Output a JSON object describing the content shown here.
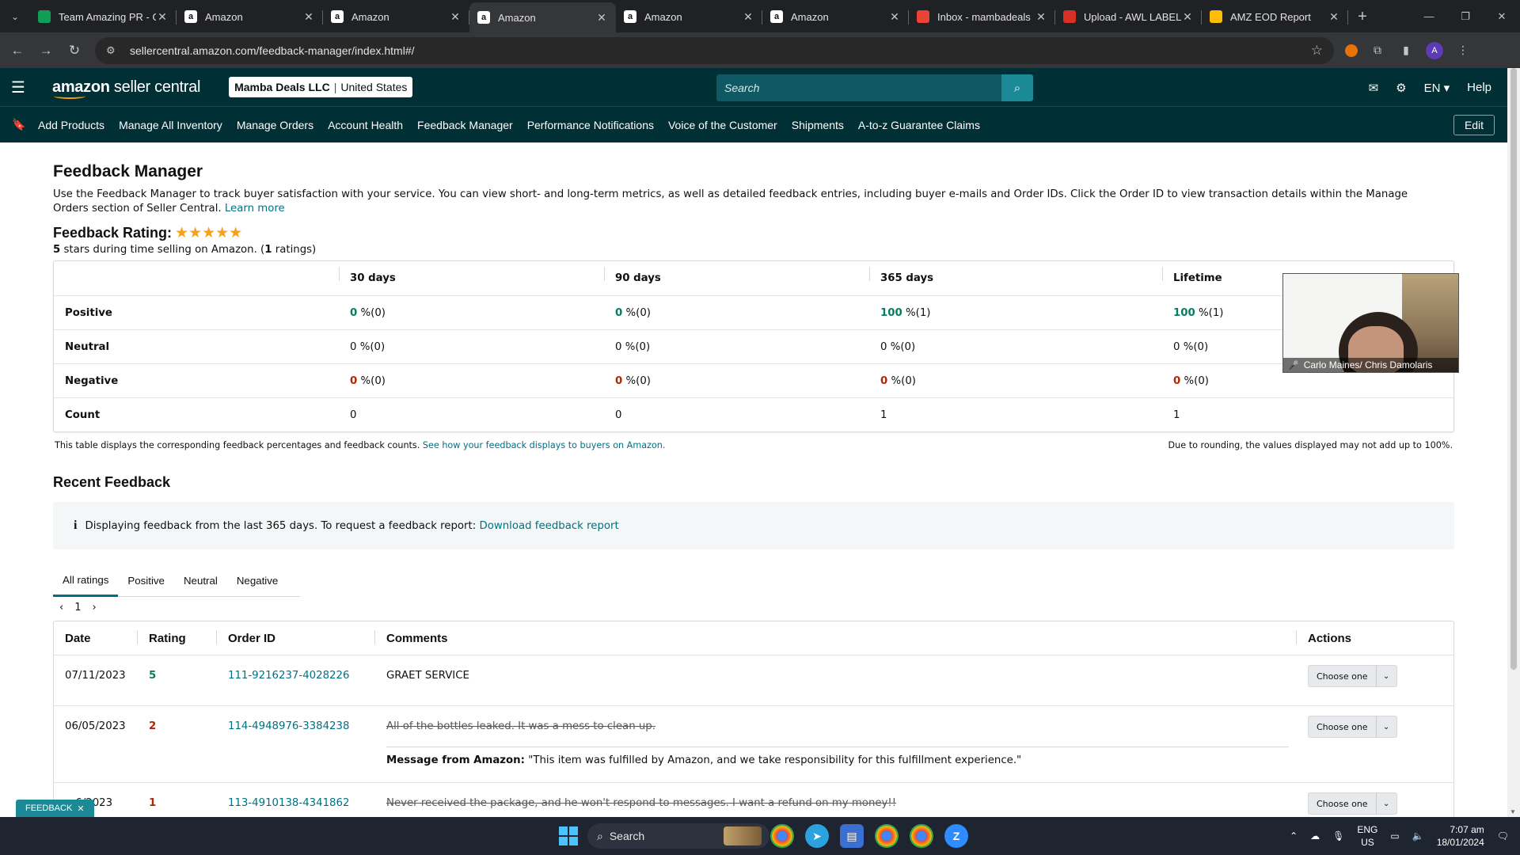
{
  "browser": {
    "tabs": [
      {
        "title": "Team Amazing PR - G",
        "icon": "sheets-icon",
        "color": "#0f9d58"
      },
      {
        "title": "Amazon",
        "icon": "amazon-icon",
        "color": "#ffffff"
      },
      {
        "title": "Amazon",
        "icon": "amazon-icon",
        "color": "#ffffff"
      },
      {
        "title": "Amazon",
        "icon": "amazon-icon",
        "color": "#ffffff",
        "active": true
      },
      {
        "title": "Amazon",
        "icon": "amazon-icon",
        "color": "#ffffff"
      },
      {
        "title": "Amazon",
        "icon": "amazon-icon",
        "color": "#ffffff"
      },
      {
        "title": "Inbox - mambadeals",
        "icon": "gmail-icon",
        "color": "#ea4335"
      },
      {
        "title": "Upload - AWL LABEL",
        "icon": "upload-icon",
        "color": "#d93025"
      },
      {
        "title": "AMZ EOD Report",
        "icon": "report-icon",
        "color": "#fbbc04"
      }
    ],
    "url": "sellercentral.amazon.com/feedback-manager/index.html#/",
    "profile_initial": "A"
  },
  "header": {
    "logo_bold": "amazon",
    "logo_rest": " seller central",
    "account_name": "Mamba Deals LLC",
    "account_region": "United States",
    "search_placeholder": "Search",
    "lang": "EN",
    "help": "Help"
  },
  "nav": {
    "items": [
      "Add Products",
      "Manage All Inventory",
      "Manage Orders",
      "Account Health",
      "Feedback Manager",
      "Performance Notifications",
      "Voice of the Customer",
      "Shipments",
      "A-to-z Guarantee Claims"
    ],
    "edit": "Edit"
  },
  "page": {
    "title": "Feedback Manager",
    "intro": "Use the Feedback Manager to track buyer satisfaction with your service. You can view short- and long-term metrics, as well as detailed feedback entries, including buyer e-mails and Order IDs. Click the Order ID to view transaction details within the Manage Orders section of Seller Central.",
    "learn_more": "Learn more",
    "rating_label": "Feedback Rating:",
    "stars": "★★★★★",
    "rating_stars_value": 5,
    "rating_sub_num": "5",
    "rating_sub_mid": " stars during time selling on Amazon. (",
    "rating_sub_count": "1",
    "rating_sub_end": " ratings)"
  },
  "summary": {
    "columns": [
      "",
      "30 days",
      "90 days",
      "365 days",
      "Lifetime"
    ],
    "rows": [
      {
        "label": "Positive",
        "cells": [
          [
            "0",
            " %(0)"
          ],
          [
            "0",
            " %(0)"
          ],
          [
            "100",
            " %(1)"
          ],
          [
            "100",
            " %(1)"
          ]
        ],
        "tone": "g"
      },
      {
        "label": "Neutral",
        "cells": [
          [
            "0",
            " %(0)"
          ],
          [
            "0",
            " %(0)"
          ],
          [
            "0",
            " %(0)"
          ],
          [
            "0",
            " %(0)"
          ]
        ],
        "tone": "n"
      },
      {
        "label": "Negative",
        "cells": [
          [
            "0",
            " %(0)"
          ],
          [
            "0",
            " %(0)"
          ],
          [
            "0",
            " %(0)"
          ],
          [
            "0",
            " %(0)"
          ]
        ],
        "tone": "r"
      },
      {
        "label": "Count",
        "cells": [
          [
            "",
            "0"
          ],
          [
            "",
            "0"
          ],
          [
            "",
            "1"
          ],
          [
            "",
            "1"
          ]
        ],
        "tone": "n"
      }
    ],
    "note_left": "This table displays the corresponding feedback percentages and feedback counts.",
    "note_link": "See how your feedback displays to buyers on Amazon.",
    "note_right": "Due to rounding, the values displayed may not add up to 100%."
  },
  "recent": {
    "title": "Recent Feedback",
    "info_text": "Displaying feedback from the last 365 days. To request a feedback report:",
    "info_link": "Download feedback report",
    "tabs": [
      "All ratings",
      "Positive",
      "Neutral",
      "Negative"
    ],
    "page": "1",
    "columns": [
      "Date",
      "Rating",
      "Order ID",
      "Comments",
      "Actions"
    ],
    "rows": [
      {
        "date": "07/11/2023",
        "rating": "5",
        "tone": "g",
        "order": "111-9216237-4028226",
        "comment": "GRAET SERVICE",
        "strike": false,
        "message": null
      },
      {
        "date": "06/05/2023",
        "rating": "2",
        "tone": "r",
        "order": "114-4948976-3384238",
        "comment": "All of the bottles leaked. It was a mess to clean up.",
        "strike": true,
        "message": "\"This item was fulfilled by Amazon, and we take responsibility for this fulfillment experience.\""
      },
      {
        "date": "…6/2023",
        "rating": "1",
        "tone": "r",
        "order": "113-4910138-4341862",
        "comment": "Never received the package, and he won't respond to messages. I want a refund on my money!!",
        "strike": true,
        "message": null
      }
    ],
    "message_label": "Message from Amazon:",
    "action_label": "Choose one"
  },
  "feedback_button": "FEEDBACK",
  "video": {
    "caption": "Carlo Maines/ Chris Damolaris"
  },
  "taskbar": {
    "search": "Search",
    "lang_top": "ENG",
    "lang_bottom": "US",
    "time": "7:07 am",
    "date": "18/01/2024"
  }
}
